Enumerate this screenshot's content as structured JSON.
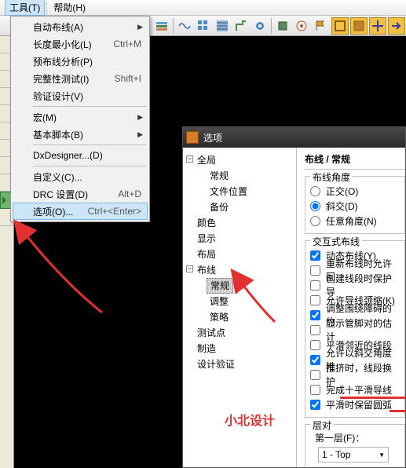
{
  "menubar": {
    "tools": "工具(T)",
    "help": "帮助(H)"
  },
  "dropdown": {
    "autoroute": "自动布线(A)",
    "minlen": "长度最小化(L)",
    "minlen_sc": "Ctrl+M",
    "preroute": "预布线分析(P)",
    "integrity": "完整性测试(I)",
    "integrity_sc": "Shift+I",
    "verify": "验证设计(V)",
    "macro": "宏(M)",
    "script": "基本脚本(B)",
    "dxd": "DxDesigner...(D)",
    "custom": "自定义(C)...",
    "drc": "DRC 设置(D)",
    "drc_sc": "Alt+D",
    "options": "选项(O)...",
    "options_sc": "Ctrl+<Enter>"
  },
  "tree": {
    "global": "全局",
    "general": "常规",
    "fileloc": "文件位置",
    "backup": "备份",
    "color": "颜色",
    "display": "显示",
    "layout": "布局",
    "routing": "布线",
    "r_general": "常规",
    "r_tune": "调整",
    "r_strategy": "策略",
    "testpoint": "测试点",
    "mfg": "制造",
    "designver": "设计验证"
  },
  "dialog": {
    "title": "选项",
    "header": "布线 / 常规",
    "grp_angle": "布线角度",
    "a_ortho": "正交(O)",
    "a_diag": "斜交(D)",
    "a_any": "任意角度(N)",
    "grp_inter": "交互式布线",
    "c1": "动态布线(Y)",
    "c2": "重新布线时允许回",
    "c3": "创建线段时保护导",
    "c4": "允许导线颈缩(K)",
    "c5": "调整围绕障碍的约",
    "c6": "显示管脚对的估计",
    "c7": "平滑邻近的线段",
    "c8": "允许以斜交角度推",
    "c9": "推挤时，线段换护",
    "c10": "完成十平滑导线",
    "c11": "平滑时保留圆弧",
    "grp_layer": "层对",
    "layer_lbl": "第一层(F)：",
    "layer_val": "1 - Top"
  },
  "watermark": "小北设计"
}
